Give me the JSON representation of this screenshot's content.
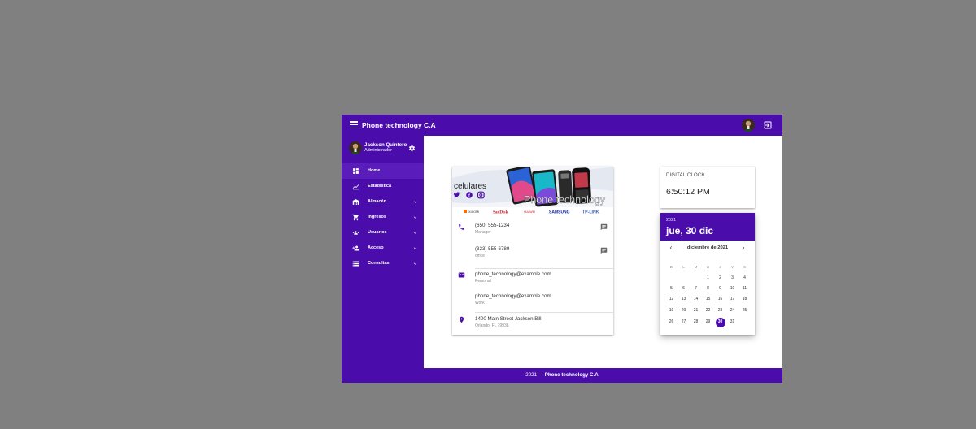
{
  "app": {
    "title": "Phone technology C.A"
  },
  "user": {
    "name": "Jackson Quintero",
    "role": "Administrador"
  },
  "nav": {
    "items": [
      {
        "label": "Home",
        "icon": "dashboard-icon",
        "active": true
      },
      {
        "label": "Estadistica",
        "icon": "chart-icon"
      },
      {
        "label": "Almacén",
        "icon": "warehouse-icon",
        "expandable": true
      },
      {
        "label": "Ingresos",
        "icon": "cart-icon",
        "expandable": true
      },
      {
        "label": "Usuarios",
        "icon": "users-icon",
        "expandable": true
      },
      {
        "label": "Acceso",
        "icon": "person-add-icon",
        "expandable": true
      },
      {
        "label": "Consultas",
        "icon": "storage-icon",
        "expandable": true
      }
    ]
  },
  "banner": {
    "text_left": "celulares",
    "text_main": "Phone technology",
    "brands": [
      "XIAOMI",
      "SanDisk",
      "HUAWEI",
      "SAMSUNG",
      "TP-LINK"
    ]
  },
  "contact": {
    "phone1": {
      "number": "(650) 555-1234",
      "label": "Manager"
    },
    "phone2": {
      "number": "(323) 555-6789",
      "label": "office"
    },
    "email1": {
      "address": "phone_technology@example.com",
      "label": "Personal"
    },
    "email2": {
      "address": "phone_technology@example.com",
      "label": "Work"
    },
    "address": {
      "street": "1400 Main Street Jackson Bill",
      "city": "Orlando, FL 79938"
    }
  },
  "clock": {
    "title": "DIGITAL CLOCK",
    "time": "6:50:12 PM"
  },
  "calendar": {
    "year": "2021",
    "selected_label": "jue, 30 dic",
    "month_label": "diciembre de 2021",
    "weekdays": [
      "D",
      "L",
      "M",
      "X",
      "J",
      "V",
      "S"
    ],
    "selected_day": "30"
  },
  "footer": {
    "year": "2021",
    "separator": "—",
    "company": "Phone technology C.A"
  },
  "colors": {
    "primary": "#4a0dab",
    "background": "#808080"
  }
}
